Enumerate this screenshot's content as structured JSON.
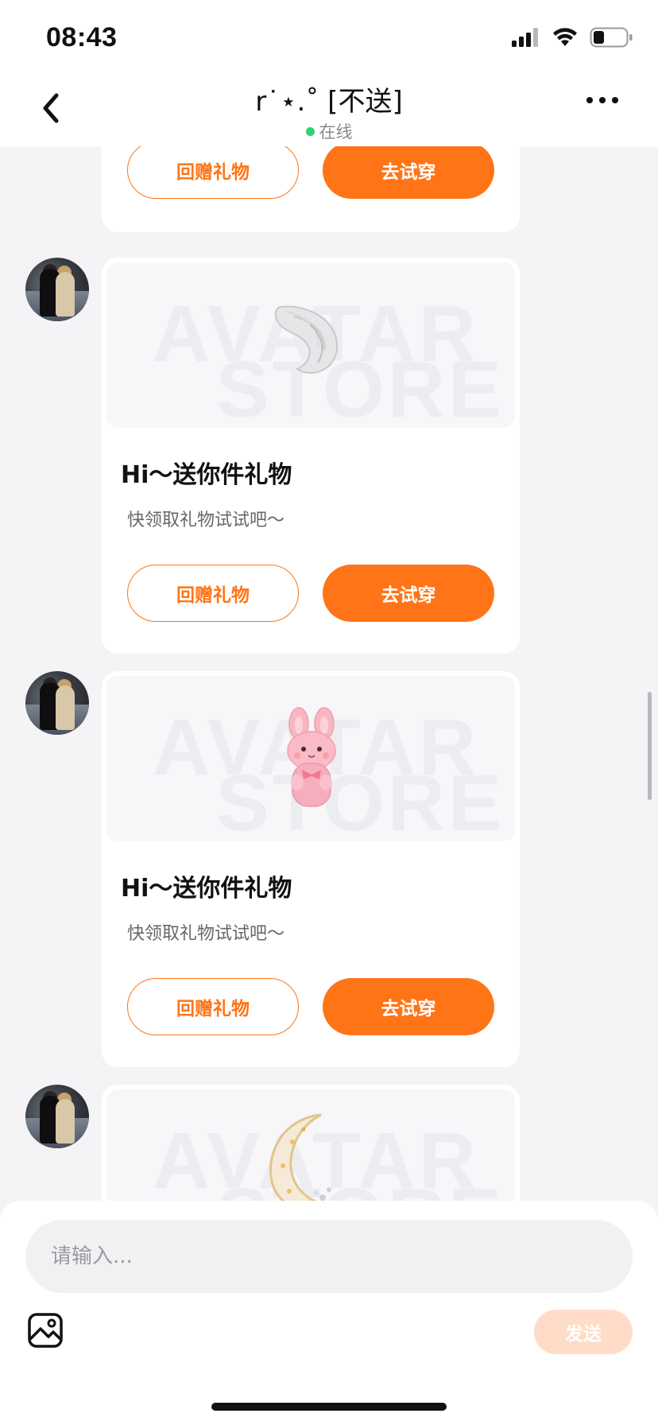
{
  "status_bar": {
    "time": "08:43",
    "icons": [
      "cellular-signal-icon",
      "wifi-icon",
      "battery-icon"
    ]
  },
  "nav": {
    "title": "r˙⋆.˚ [不送]",
    "status": "在线",
    "online_color": "#2ed36f",
    "icons": [
      "back-chevron-icon",
      "more-dots-icon"
    ]
  },
  "accent_color": "#ff7416",
  "messages": [
    {
      "gift_image_icon": "",
      "title": "",
      "subtitle": "",
      "return_gift_label": "回赠礼物",
      "try_on_label": "去试穿"
    },
    {
      "gift_image_icon": "white-fluffy-tail-icon",
      "watermark_line1": "AVATAR",
      "watermark_line2": "STORE",
      "title": "Hi～送你件礼物",
      "subtitle": "快领取礼物试试吧～",
      "return_gift_label": "回赠礼物",
      "try_on_label": "去试穿"
    },
    {
      "gift_image_icon": "pink-bunny-plush-icon",
      "watermark_line1": "AVATAR",
      "watermark_line2": "STORE",
      "title": "Hi～送你件礼物",
      "subtitle": "快领取礼物试试吧～",
      "return_gift_label": "回赠礼物",
      "try_on_label": "去试穿"
    },
    {
      "gift_image_icon": "crescent-moon-ornament-icon",
      "watermark_line1": "AVATAR",
      "watermark_line2": "STORE"
    }
  ],
  "composer": {
    "placeholder": "请输入...",
    "send_label": "发送",
    "image_icon": "image-picker-icon"
  }
}
